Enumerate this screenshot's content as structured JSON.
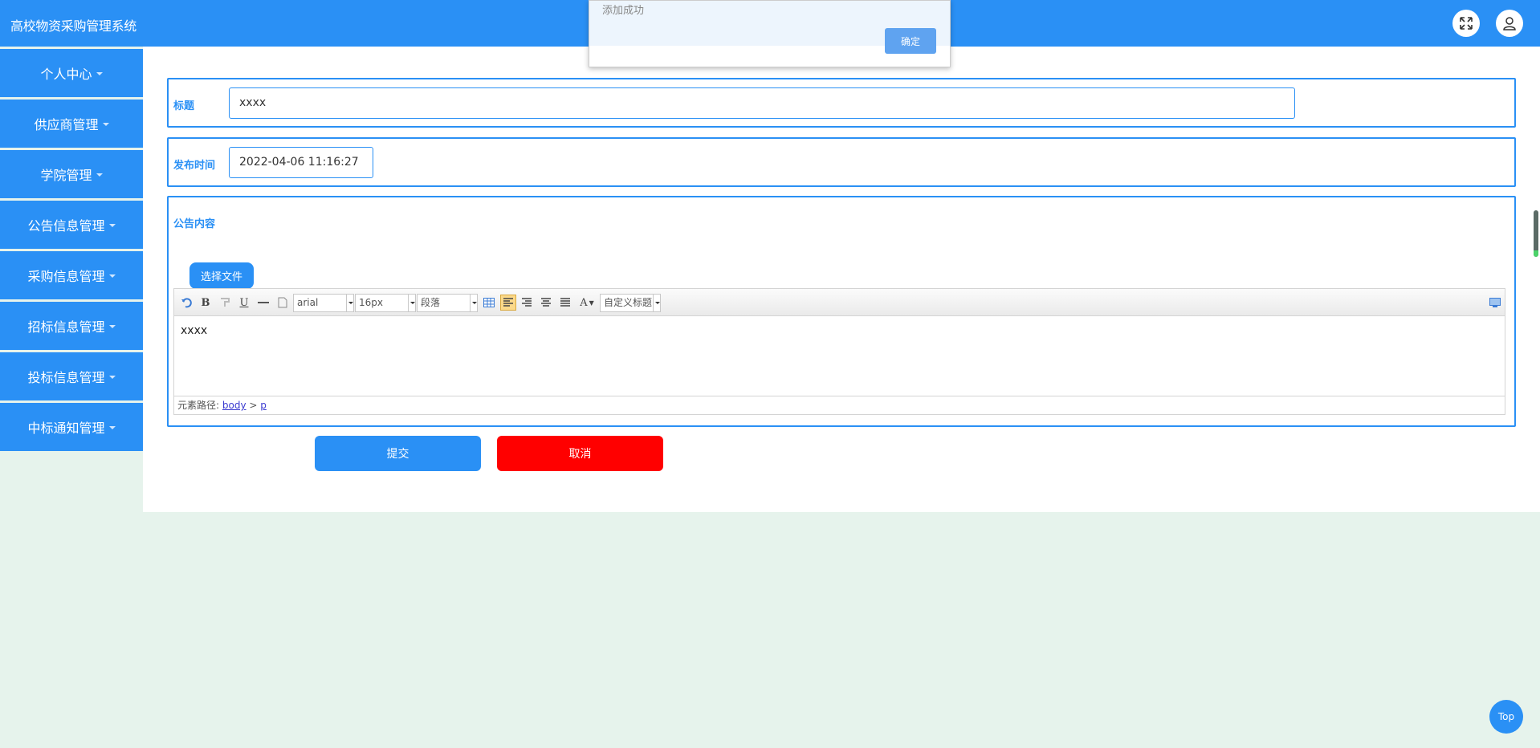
{
  "app": {
    "title": "高校物资采购管理系统"
  },
  "header": {
    "fullscreen_icon": "expand-icon",
    "user_icon": "user-icon"
  },
  "sidebar": {
    "items": [
      {
        "label": "个人中心"
      },
      {
        "label": "供应商管理"
      },
      {
        "label": "学院管理"
      },
      {
        "label": "公告信息管理"
      },
      {
        "label": "采购信息管理"
      },
      {
        "label": "招标信息管理"
      },
      {
        "label": "投标信息管理"
      },
      {
        "label": "中标通知管理"
      }
    ]
  },
  "form": {
    "title_label": "标题",
    "title_value": "xxxx",
    "time_label": "发布时间",
    "time_value": "2022-04-06 11:16:27",
    "content_label": "公告内容",
    "file_button": "选择文件",
    "editor": {
      "font_family": "arial",
      "font_size": "16px",
      "paragraph": "段落",
      "custom_heading": "自定义标题",
      "body_text": "xxxx",
      "path_label": "元素路径:",
      "path_body": "body",
      "path_sep": ">",
      "path_p": "p"
    },
    "submit_label": "提交",
    "cancel_label": "取消"
  },
  "dialog": {
    "message": "添加成功",
    "ok_label": "确定"
  },
  "top_button": "Top",
  "colors": {
    "primary": "#2a90f5",
    "danger": "#ff0000",
    "background": "#e6f3ec"
  }
}
